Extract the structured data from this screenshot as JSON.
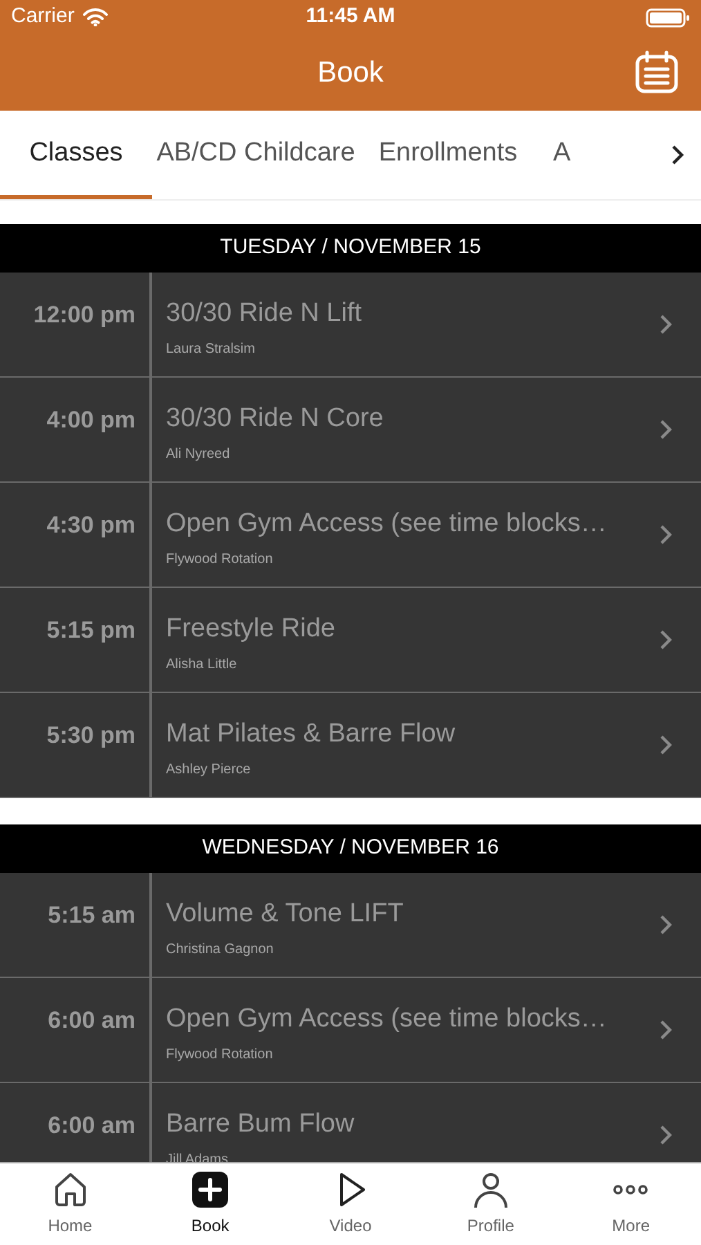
{
  "status_bar": {
    "carrier": "Carrier",
    "time": "11:45 AM"
  },
  "nav": {
    "title": "Book"
  },
  "tabs": [
    {
      "label": "Classes",
      "selected": true
    },
    {
      "label": "AB/CD Childcare",
      "selected": false
    },
    {
      "label": "Enrollments",
      "selected": false
    },
    {
      "label": "A",
      "selected": false
    }
  ],
  "days": [
    {
      "header": "TUESDAY / NOVEMBER 15",
      "classes": [
        {
          "time": "12:00 pm",
          "name": "30/30 Ride N Lift",
          "instructor": "Laura Stralsim"
        },
        {
          "time": "4:00 pm",
          "name": "30/30 Ride N Core",
          "instructor": "Ali Nyreed"
        },
        {
          "time": "4:30 pm",
          "name": "Open Gym Access (see time blocks…",
          "instructor": "Flywood Rotation"
        },
        {
          "time": "5:15 pm",
          "name": "Freestyle Ride",
          "instructor": "Alisha Little"
        },
        {
          "time": "5:30 pm",
          "name": "Mat Pilates & Barre Flow",
          "instructor": "Ashley Pierce"
        }
      ]
    },
    {
      "header": "WEDNESDAY / NOVEMBER 16",
      "classes": [
        {
          "time": "5:15 am",
          "name": "Volume & Tone LIFT",
          "instructor": "Christina Gagnon"
        },
        {
          "time": "6:00 am",
          "name": "Open Gym Access (see time blocks…",
          "instructor": "Flywood Rotation"
        },
        {
          "time": "6:00 am",
          "name": "Barre Bum Flow",
          "instructor": "Jill Adams"
        }
      ]
    }
  ],
  "tab_bar": [
    {
      "kind": "home",
      "label": "Home",
      "selected": false
    },
    {
      "kind": "book",
      "label": "Book",
      "selected": true
    },
    {
      "kind": "video",
      "label": "Video",
      "selected": false
    },
    {
      "kind": "profile",
      "label": "Profile",
      "selected": false
    },
    {
      "kind": "more",
      "label": "More",
      "selected": false
    }
  ]
}
